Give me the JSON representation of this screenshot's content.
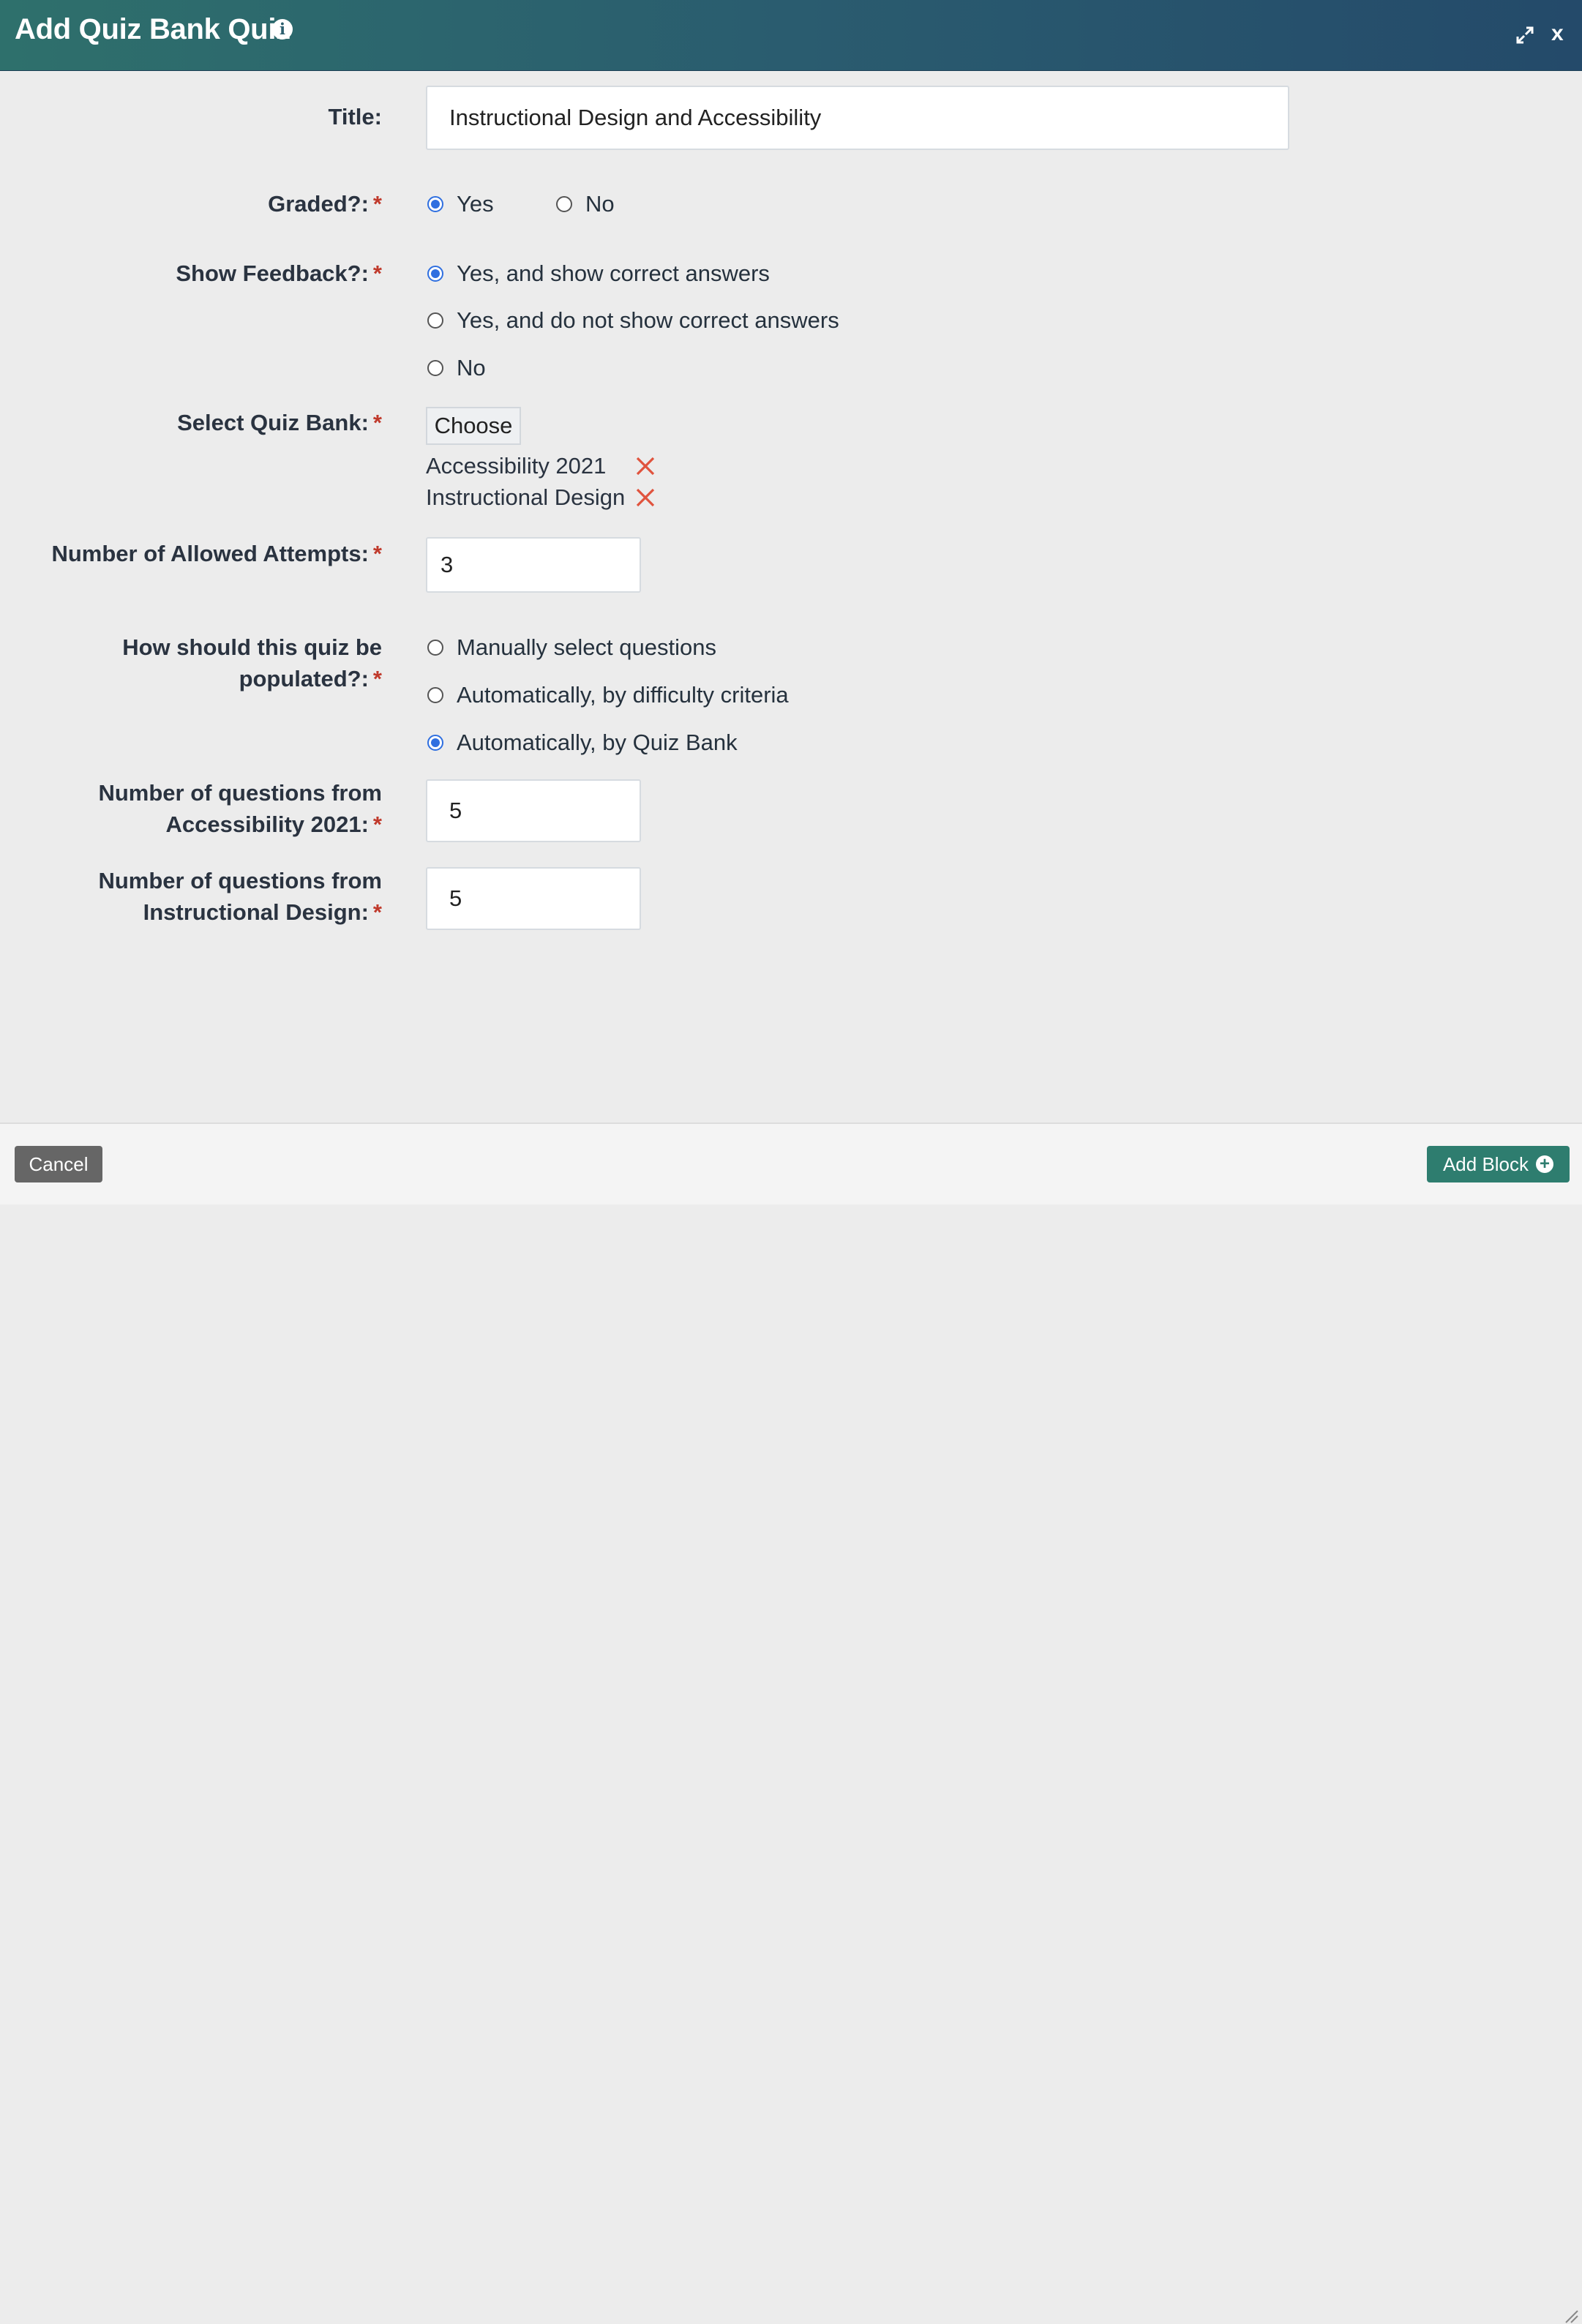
{
  "dialog": {
    "title": "Add Quiz Bank Quiz",
    "info_icon": "info-icon",
    "expand_icon": "expand-icon",
    "close_label": "x"
  },
  "form": {
    "required_mark": "*",
    "title": {
      "label": "Title:",
      "value": "Instructional Design and Accessibility"
    },
    "graded": {
      "label": "Graded?:",
      "options": [
        {
          "label": "Yes",
          "checked": true
        },
        {
          "label": "No",
          "checked": false
        }
      ]
    },
    "show_feedback": {
      "label": "Show Feedback?:",
      "options": [
        {
          "label": "Yes, and show correct answers",
          "checked": true
        },
        {
          "label": "Yes, and do not show correct answers",
          "checked": false
        },
        {
          "label": "No",
          "checked": false
        }
      ]
    },
    "quiz_bank": {
      "label": "Select Quiz Bank:",
      "choose_label": "Choose",
      "selected": [
        "Accessibility 2021",
        "Instructional Design"
      ],
      "remove_icon": "x-remove-icon"
    },
    "attempts": {
      "label": "Number of Allowed Attempts:",
      "value": "3"
    },
    "population": {
      "label_line1": "How should this quiz be",
      "label_line2": "populated?:",
      "options": [
        {
          "label": "Manually select questions",
          "checked": false
        },
        {
          "label": "Automatically, by difficulty criteria",
          "checked": false
        },
        {
          "label": "Automatically, by Quiz Bank",
          "checked": true
        }
      ]
    },
    "questions_from": [
      {
        "label_line1": "Number of questions from",
        "label_line2": "Accessibility 2021:",
        "value": "5"
      },
      {
        "label_line1": "Number of questions from",
        "label_line2": "Instructional Design:",
        "value": "5"
      }
    ]
  },
  "footer": {
    "cancel_label": "Cancel",
    "add_label": "Add Block"
  },
  "colors": {
    "header_start": "#2e706c",
    "header_end": "#244a6a",
    "radio_checked": "#2f6fe0",
    "required": "#c0392b",
    "remove": "#e0533d",
    "add_button": "#2e7d6f",
    "cancel_button": "#666666"
  }
}
